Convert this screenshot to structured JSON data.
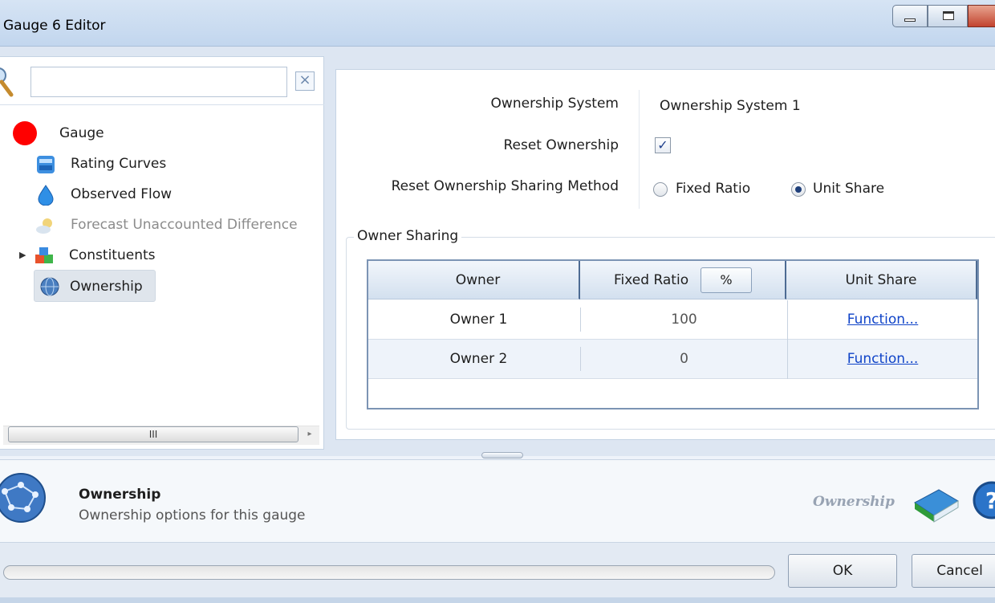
{
  "window": {
    "title": "Gauge 6 Editor"
  },
  "search": {
    "placeholder": "",
    "value": "",
    "clear_glyph": "×"
  },
  "tree": [
    {
      "label": "Gauge",
      "icon": "red-circle-icon"
    },
    {
      "label": "Rating Curves",
      "icon": "rating-curves-icon"
    },
    {
      "label": "Observed Flow",
      "icon": "water-drop-icon"
    },
    {
      "label": "Forecast Unaccounted Difference",
      "icon": "forecast-sun-icon",
      "disabled": true
    },
    {
      "label": "Constituents",
      "icon": "constituents-cubes-icon",
      "expandable": true
    },
    {
      "label": "Ownership",
      "icon": "ownership-globe-icon",
      "selected": true
    }
  ],
  "scrollbar": {
    "thumb_glyph": "III",
    "right_arrow": "▸"
  },
  "form": {
    "ownership_system_label": "Ownership System",
    "ownership_system_value": "Ownership System 1",
    "reset_ownership_label": "Reset Ownership",
    "reset_ownership_checked": true,
    "reset_method_label": "Reset Ownership Sharing Method",
    "reset_method_options": [
      "Fixed Ratio",
      "Unit Share"
    ],
    "reset_method_selected": "Unit Share"
  },
  "owner_sharing": {
    "title": "Owner Sharing",
    "columns": [
      "Owner",
      "Fixed Ratio",
      "Unit Share"
    ],
    "unit_button": "%",
    "rows": [
      {
        "owner": "Owner 1",
        "fixed_ratio": "100",
        "unit_share": "Function..."
      },
      {
        "owner": "Owner 2",
        "fixed_ratio": "0",
        "unit_share": "Function..."
      }
    ]
  },
  "info": {
    "title": "Ownership",
    "description": "Ownership options for this gauge",
    "help_link": "Ownership"
  },
  "buttons": {
    "ok": "OK",
    "cancel": "Cancel"
  },
  "colors": {
    "accent": "#1f3f7a",
    "link": "#1044c8",
    "gauge_dot": "#ff0000"
  }
}
